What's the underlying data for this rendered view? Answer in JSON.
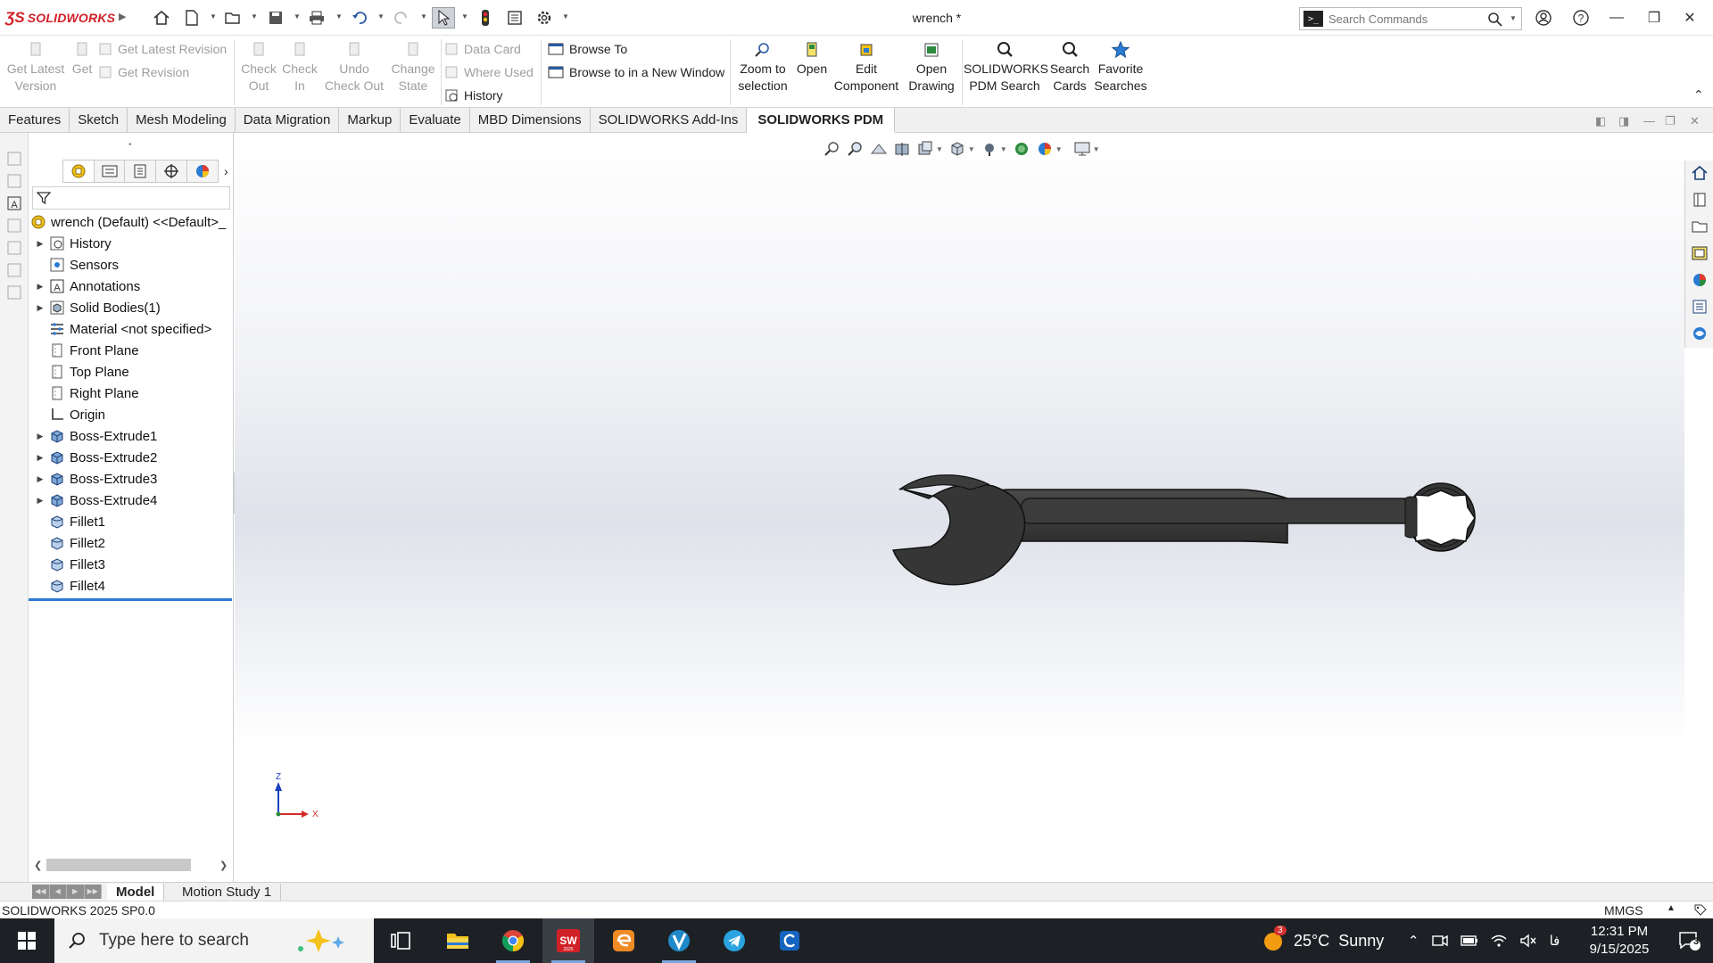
{
  "titlebar": {
    "brand": "SOLIDWORKS",
    "document_title": "wrench *",
    "search_placeholder": "Search Commands"
  },
  "ribbon": {
    "pdm_left": [
      {
        "label_l1": "Get Latest",
        "label_l2": "Version"
      },
      {
        "label_l1": "Get",
        "label_l2": ""
      }
    ],
    "pdm_small_a": [
      "Get Latest Revision",
      "Get Revision"
    ],
    "pdm_mid": [
      {
        "label_l1": "Check",
        "label_l2": "Out"
      },
      {
        "label_l1": "Check",
        "label_l2": "In"
      },
      {
        "label_l1": "Undo",
        "label_l2": "Check Out"
      },
      {
        "label_l1": "Change",
        "label_l2": "State"
      }
    ],
    "pdm_small_b": [
      "Data Card",
      "Where Used",
      "History"
    ],
    "pdm_small_c": [
      "Browse To",
      "Browse to in a New Window"
    ],
    "pdm_right": [
      {
        "label_l1": "Zoom to",
        "label_l2": "selection"
      },
      {
        "label_l1": "Open",
        "label_l2": ""
      },
      {
        "label_l1": "Edit",
        "label_l2": "Component"
      },
      {
        "label_l1": "Open",
        "label_l2": "Drawing"
      },
      {
        "label_l1": "SOLIDWORKS",
        "label_l2": "PDM Search"
      },
      {
        "label_l1": "Search",
        "label_l2": "Cards"
      },
      {
        "label_l1": "Favorite",
        "label_l2": "Searches"
      }
    ]
  },
  "tabs": [
    "Features",
    "Sketch",
    "Mesh Modeling",
    "Data Migration",
    "Markup",
    "Evaluate",
    "MBD Dimensions",
    "SOLIDWORKS Add-Ins",
    "SOLIDWORKS PDM"
  ],
  "active_tab": "SOLIDWORKS PDM",
  "tree": {
    "root": "wrench (Default) <<Default>_",
    "items": [
      {
        "label": "History",
        "expandable": true,
        "icon": "history-icon"
      },
      {
        "label": "Sensors",
        "expandable": false,
        "icon": "sensor-icon"
      },
      {
        "label": "Annotations",
        "expandable": true,
        "icon": "annotation-icon"
      },
      {
        "label": "Solid Bodies(1)",
        "expandable": true,
        "icon": "solid-bodies-icon"
      },
      {
        "label": "Material <not specified>",
        "expandable": false,
        "icon": "material-icon"
      },
      {
        "label": "Front Plane",
        "expandable": false,
        "icon": "plane-icon"
      },
      {
        "label": "Top Plane",
        "expandable": false,
        "icon": "plane-icon"
      },
      {
        "label": "Right Plane",
        "expandable": false,
        "icon": "plane-icon"
      },
      {
        "label": "Origin",
        "expandable": false,
        "icon": "origin-icon"
      },
      {
        "label": "Boss-Extrude1",
        "expandable": true,
        "icon": "extrude-icon"
      },
      {
        "label": "Boss-Extrude2",
        "expandable": true,
        "icon": "extrude-icon"
      },
      {
        "label": "Boss-Extrude3",
        "expandable": true,
        "icon": "extrude-icon"
      },
      {
        "label": "Boss-Extrude4",
        "expandable": true,
        "icon": "extrude-icon"
      },
      {
        "label": "Fillet1",
        "expandable": false,
        "icon": "fillet-icon"
      },
      {
        "label": "Fillet2",
        "expandable": false,
        "icon": "fillet-icon"
      },
      {
        "label": "Fillet3",
        "expandable": false,
        "icon": "fillet-icon"
      },
      {
        "label": "Fillet4",
        "expandable": false,
        "icon": "fillet-icon"
      }
    ]
  },
  "triad": {
    "z_label": "Z",
    "x_label": "X"
  },
  "bottom_tabs": [
    "Model",
    "Motion Study 1"
  ],
  "status": {
    "version": "SOLIDWORKS 2025 SP0.0",
    "units": "MMGS"
  },
  "taskbar": {
    "search_placeholder": "Type here to search",
    "weather_temp": "25°C",
    "weather_text": "Sunny",
    "weather_badge": "3",
    "time": "12:31 PM",
    "date": "9/15/2025",
    "notifications": "3",
    "lang": "فا"
  },
  "colors": {
    "brand_red": "#d22027",
    "accent_blue": "#2a7bd4",
    "wrench_body": "#3a3a3a",
    "taskbar_bg": "#1d2125"
  }
}
